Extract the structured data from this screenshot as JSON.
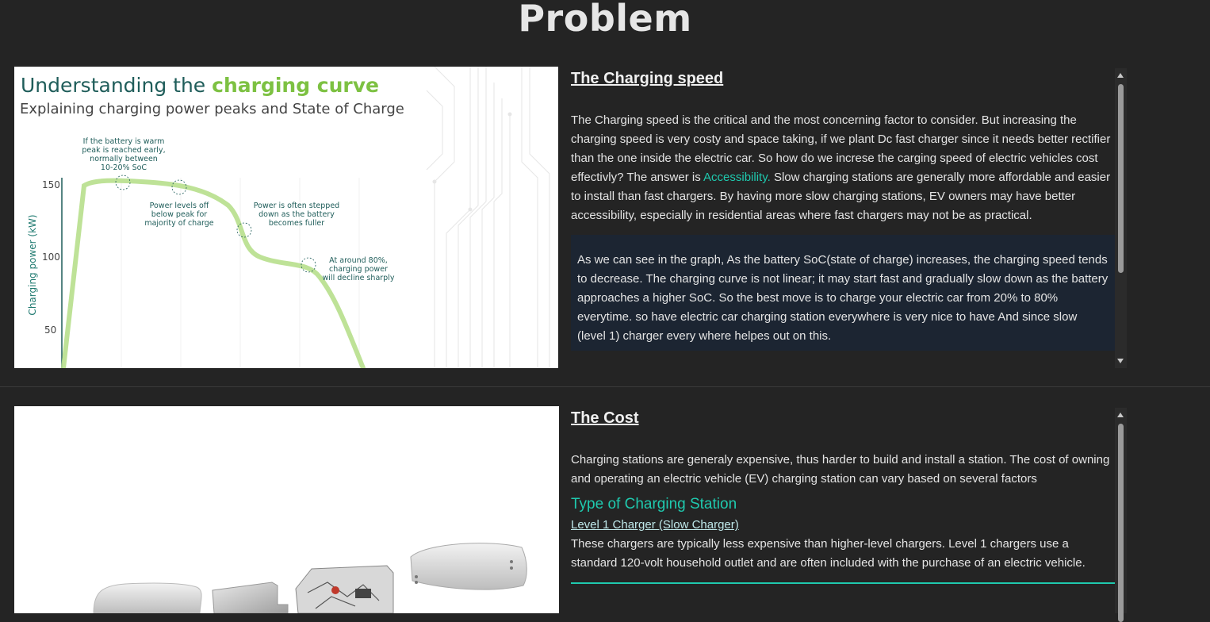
{
  "page": {
    "title": "Problem"
  },
  "section1": {
    "image": {
      "title_prefix": "Understanding the ",
      "title_highlight": "charging curve",
      "subtitle": "Explaining charging power peaks and State of Charge",
      "ylabel": "Charging power (kW)",
      "yticks": [
        "150",
        "100",
        "50"
      ],
      "annotations": {
        "a1": [
          "If the battery is warm",
          "peak is reached early,",
          "normally between",
          "10-20% SoC"
        ],
        "a2": [
          "Power levels off",
          "below peak for",
          "majority of charge"
        ],
        "a3": [
          "Power is often stepped",
          "down as the battery",
          "becomes fuller"
        ],
        "a4": [
          "At around 80%,",
          "charging power",
          "will decline sharply"
        ]
      },
      "colors": {
        "title": "#1f5d5a",
        "highlight": "#7dc142",
        "curve": "#a9d77a"
      }
    },
    "heading": "The Charging speed",
    "para1_before": "The Charging speed is the critical and the most concerning factor to consider. But increasing the charging speed is very costy and space taking, if we plant Dc fast charger since it needs better rectifier than the one inside the electric car. So how do we increse the carging speed of electric vehicles cost effectivly? The answer is ",
    "para1_link": "Accessibility.",
    "para1_after": " Slow charging stations are generally more affordable and easier to install than fast chargers. By having more slow charging stations, EV owners may have better accessibility, especially in residential areas where fast chargers may not be as practical.",
    "note": "As we can see in the graph, As the battery SoC(state of charge) increases, the charging speed tends to decrease. The charging curve is not linear; it may start fast and gradually slow down as the battery approaches a higher SoC. So the best move is to charge your electric car from 20% to 80% everytime. so have electric car charging station everywhere is very nice to have And since slow (level 1) charger every where helpes out on this."
  },
  "section2": {
    "heading": "The Cost",
    "para1": "Charging stations are generaly expensive, thus harder to build and install a station. The cost of owning and operating an electric vehicle (EV) charging station can vary based on several factors",
    "subheading": "Type of Charging Station",
    "level1_link": "Level 1 Charger (Slow Charger)",
    "level1_text": "These chargers are typically less expensive than higher-level chargers. Level 1 chargers use a standard 120-volt household outlet and are often included with the purchase of an electric vehicle."
  },
  "colors": {
    "accent": "#1fc9ae",
    "background": "#242424",
    "note_bg": "#1c2532"
  }
}
